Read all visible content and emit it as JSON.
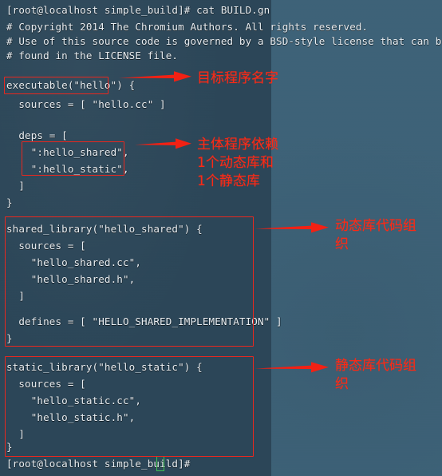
{
  "terminal": {
    "prompt_command_line": "[root@localhost simple_build]# cat BUILD.gn",
    "file_lines": [
      "# Copyright 2014 The Chromium Authors. All rights reserved.",
      "# Use of this source code is governed by a BSD-style license that can be",
      "# found in the LICENSE file.",
      "",
      "executable(\"hello\") {",
      "  sources = [ \"hello.cc\" ]",
      "",
      "  deps = [",
      "    \":hello_shared\",",
      "    \":hello_static\",",
      "  ]",
      "}",
      "",
      "shared_library(\"hello_shared\") {",
      "  sources = [",
      "    \"hello_shared.cc\",",
      "    \"hello_shared.h\",",
      "  ]",
      "",
      "  defines = [ \"HELLO_SHARED_IMPLEMENTATION\" ]",
      "}",
      "",
      "static_library(\"hello_static\") {",
      "  sources = [",
      "    \"hello_static.cc\",",
      "    \"hello_static.h\",",
      "  ]",
      "}"
    ],
    "trailing_prompt": "[root@localhost simple_build]#",
    "cursor_glyph": "block-cursor"
  },
  "annotations": [
    {
      "name": "target-program-name",
      "text": "目标程序名字"
    },
    {
      "name": "main-program-deps",
      "text": "主体程序依赖\n1个动态库和\n1个静态库"
    },
    {
      "name": "shared-library-code",
      "text": "动态库代码组\n织"
    },
    {
      "name": "static-library-code",
      "text": "静态库代码组\n织"
    }
  ],
  "colors": {
    "annotation_red": "#fa2a16",
    "box_red": "#e8281f",
    "terminal_bg": "#2b4658",
    "desktop_bg": "#3d6278",
    "terminal_fg": "#e9eef2",
    "cursor_green": "#3fbf55"
  }
}
